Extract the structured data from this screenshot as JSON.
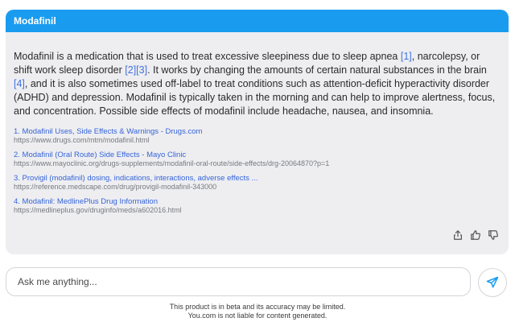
{
  "header": {
    "title": "Modafinil"
  },
  "answer": {
    "p1": "Modafinil is a medication that is used to treat excessive sleepiness due to sleep apnea ",
    "c1": "[1]",
    "p2": ", narcolepsy, or shift work sleep disorder ",
    "c2": "[2][3]",
    "p3": ". It works by changing the amounts of certain natural substances in the brain ",
    "c3": "[4]",
    "p4": ", and it is also sometimes used off-label to treat conditions such as attention-deficit hyperactivity disorder (ADHD) and depression. Modafinil is typically taken in the morning and can help to improve alertness, focus, and concentration. Possible side effects of modafinil include headache, nausea, and insomnia."
  },
  "sources": [
    {
      "title": "1. Modafinil Uses, Side Effects & Warnings - Drugs.com",
      "url": "https://www.drugs.com/mtm/modafinil.html"
    },
    {
      "title": "2. Modafinil (Oral Route) Side Effects - Mayo Clinic",
      "url": "https://www.mayoclinic.org/drugs-supplements/modafinil-oral-route/side-effects/drg-20064870?p=1"
    },
    {
      "title": "3. Provigil (modafinil) dosing, indications, interactions, adverse effects ...",
      "url": "https://reference.medscape.com/drug/provigil-modafinil-343000"
    },
    {
      "title": "4. Modafinil: MedlinePlus Drug Information",
      "url": "https://medlineplus.gov/druginfo/meds/a602016.html"
    }
  ],
  "actions": {
    "icons": [
      "share-icon",
      "thumbs-up-icon",
      "thumbs-down-icon"
    ]
  },
  "input": {
    "placeholder": "Ask me anything..."
  },
  "footer": {
    "line1": "This product is in beta and its accuracy may be limited.",
    "line2": "You.com is not liable for content generated."
  },
  "colors": {
    "accent": "#199cf0",
    "card_bg": "#eeeef1",
    "link": "#3564d8"
  }
}
